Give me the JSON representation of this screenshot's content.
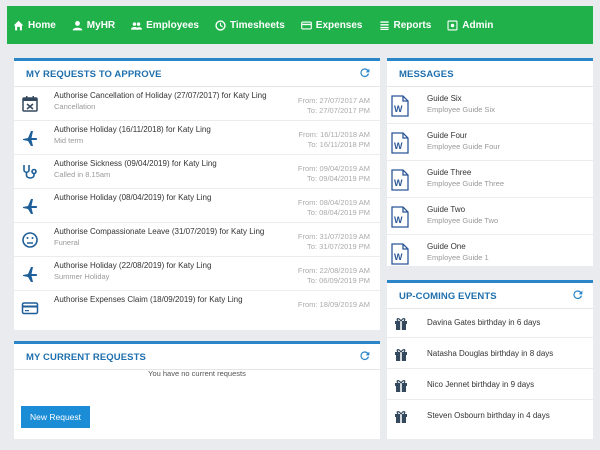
{
  "nav": {
    "items": [
      {
        "label": "Home",
        "icon": "home-icon"
      },
      {
        "label": "MyHR",
        "icon": "user-icon"
      },
      {
        "label": "Employees",
        "icon": "users-icon"
      },
      {
        "label": "Timesheets",
        "icon": "clock-icon"
      },
      {
        "label": "Expenses",
        "icon": "credit-card-icon"
      },
      {
        "label": "Reports",
        "icon": "list-icon"
      },
      {
        "label": "Admin",
        "icon": "admin-icon"
      }
    ],
    "color": "#21b14b"
  },
  "requests_panel": {
    "title": "MY REQUESTS TO APPROVE",
    "items": [
      {
        "icon": "calendar-cancel-icon",
        "title": "Authorise Cancellation of Holiday (27/07/2017) for Katy Ling",
        "sub": "Cancellation",
        "from": "From: 27/07/2017 AM",
        "to": "To: 27/07/2017 PM"
      },
      {
        "icon": "plane-icon",
        "title": "Authorise Holiday (16/11/2018) for Katy Ling",
        "sub": "Mid term",
        "from": "From: 16/11/2018 AM",
        "to": "To: 16/11/2018 PM"
      },
      {
        "icon": "stethoscope-icon",
        "title": "Authorise Sickness (09/04/2019) for Katy Ling",
        "sub": "Called in 8.15am",
        "from": "From: 09/04/2019 AM",
        "to": "To: 09/04/2019 PM"
      },
      {
        "icon": "plane-icon",
        "title": "Authorise Holiday (08/04/2019) for Katy Ling",
        "sub": "",
        "from": "From: 08/04/2019 AM",
        "to": "To: 08/04/2019 PM"
      },
      {
        "icon": "sad-face-icon",
        "title": "Authorise Compassionate Leave (31/07/2019) for Katy Ling",
        "sub": "Funeral",
        "from": "From: 31/07/2019 AM",
        "to": "To: 31/07/2019 PM"
      },
      {
        "icon": "plane-icon",
        "title": "Authorise Holiday (22/08/2019) for Katy Ling",
        "sub": "Summer Holiday",
        "from": "From: 22/08/2019 AM",
        "to": "To: 06/09/2019 PM"
      },
      {
        "icon": "credit-card-icon",
        "title": "Authorise Expenses Claim (18/09/2019) for Katy Ling",
        "sub": "",
        "from": "From: 18/09/2019 AM",
        "to": ""
      }
    ]
  },
  "current_panel": {
    "title": "MY CURRENT REQUESTS",
    "empty_text": "You have no current requests",
    "button_label": "New Request"
  },
  "messages_panel": {
    "title": "MESSAGES",
    "items": [
      {
        "title": "Guide Six",
        "sub": "Employee Guide Six"
      },
      {
        "title": "Guide Four",
        "sub": "Employee Guide Four"
      },
      {
        "title": "Guide Three",
        "sub": "Employee Guide Three"
      },
      {
        "title": "Guide Two",
        "sub": "Employee Guide Two"
      },
      {
        "title": "Guide One",
        "sub": "Employee Guide 1"
      }
    ]
  },
  "events_panel": {
    "title": "UP-COMING EVENTS",
    "items": [
      {
        "text": "Davina Gates birthday in 6 days"
      },
      {
        "text": "Natasha Douglas birthday in 8 days"
      },
      {
        "text": "Nico Jennet birthday in 9 days"
      },
      {
        "text": "Steven Osbourn birthday in 4 days"
      }
    ]
  },
  "accent_color": "#2a86c9"
}
